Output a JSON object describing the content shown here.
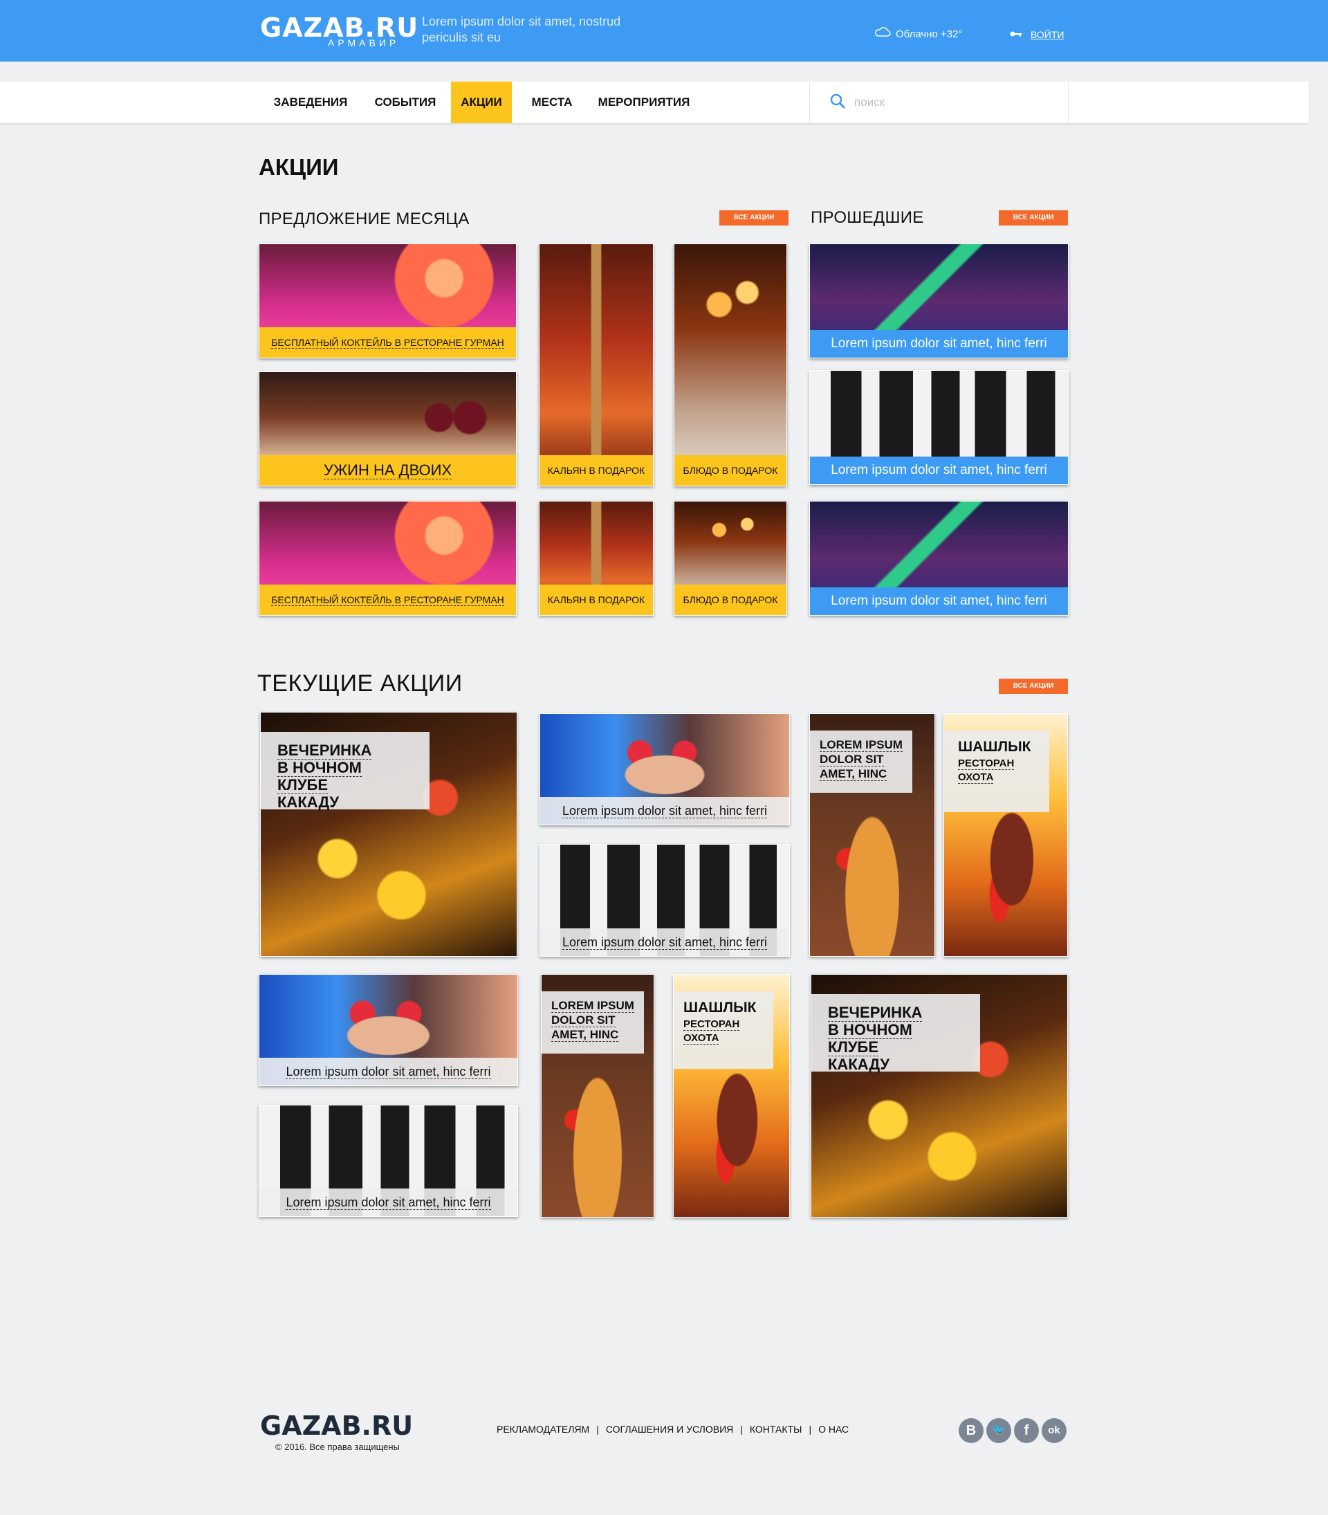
{
  "header": {
    "logo": "GAZAB.RU",
    "city": "АРМАВИР",
    "tagline": "Lorem ipsum dolor sit amet, nostrud periculis sit eu",
    "weather": "Облачно +32°",
    "login": "ВОЙТИ",
    "colors": {
      "bar": "#3d9bf3",
      "accent": "#fcc41c",
      "badge": "#f36a2a"
    }
  },
  "nav": {
    "items": [
      {
        "label": "ЗАВЕДЕНИЯ",
        "active": false
      },
      {
        "label": "СОБЫТИЯ",
        "active": false
      },
      {
        "label": "АКЦИИ",
        "active": true
      },
      {
        "label": "МЕСТА",
        "active": false
      },
      {
        "label": "МЕРОПРИЯТИЯ",
        "active": false
      }
    ],
    "search_placeholder": "поиск",
    "search_icon": "search-icon"
  },
  "page": {
    "title": "АКЦИИ"
  },
  "offer": {
    "title": "ПРЕДЛОЖЕНИЕ МЕСЯЦА",
    "all_label": "ВСЕ АКЦИИ",
    "cards": [
      "БЕСПЛАТНЫЙ КОКТЕЙЛЬ В РЕСТОРАНЕ ГУРМАН",
      "УЖИН НА ДВОИХ",
      "КАЛЬЯН В ПОДАРОК",
      "БЛЮДО В ПОДАРОК",
      "БЕСПЛАТНЫЙ КОКТЕЙЛЬ В РЕСТОРАНЕ ГУРМАН",
      "КАЛЬЯН В ПОДАРОК",
      "БЛЮДО В ПОДАРОК"
    ]
  },
  "past": {
    "title": "ПРОШЕДШИЕ",
    "all_label": "ВСЕ АКЦИИ",
    "cards": [
      "Lorem ipsum dolor sit amet, hinc ferri",
      "Lorem ipsum dolor sit amet, hinc ferri",
      "Lorem ipsum dolor sit amet, hinc ferri"
    ]
  },
  "current": {
    "title": "ТЕКУЩИЕ АКЦИИ",
    "all_label": "ВСЕ АКЦИИ",
    "party": [
      "ВЕЧЕРИНКА",
      "В НОЧНОМ КЛУБЕ",
      "КАКАДУ"
    ],
    "lorem": "Lorem ipsum dolor sit amet, hinc ferri",
    "pizza": [
      "LOREM IPSUM",
      "DOLOR SIT",
      "AMET, HINC"
    ],
    "shashlik": {
      "title": "ШАШЛЫК",
      "sub1": "РЕСТОРАН",
      "sub2": "ОХОТА"
    }
  },
  "footer": {
    "logo": "GAZAB.RU",
    "copyright": "© 2016. Все права защищены",
    "links": [
      "РЕКЛАМОДАТЕЛЯМ",
      "СОГЛАШЕНИЯ И УСЛОВИЯ",
      "КОНТАКТЫ",
      "О НАС"
    ],
    "separator": "|",
    "social": [
      {
        "icon": "vk-icon",
        "glyph": "B"
      },
      {
        "icon": "twitter-icon",
        "glyph": "🐦"
      },
      {
        "icon": "facebook-icon",
        "glyph": "f"
      },
      {
        "icon": "odnoklassniki-icon",
        "glyph": "ok"
      }
    ]
  }
}
